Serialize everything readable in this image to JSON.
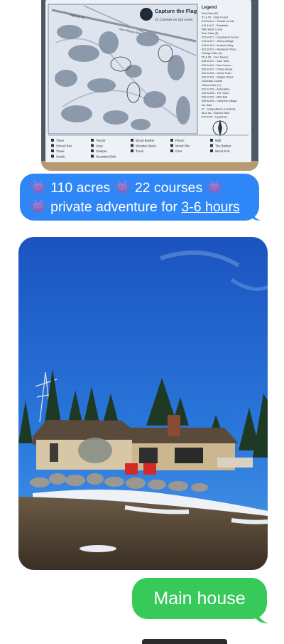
{
  "map_photo": {
    "title": "Capture the Flag",
    "subtitle": "22 Courses on 110 Acres",
    "legend_title": "Legend",
    "legend_items": [
      "Red Gate (R)",
      "#1 & #2 - Dark Forest",
      "#13 & #14 - Tractor vs Car",
      "#11 & #12 - Roadside",
      "Wild West Corral",
      "Blue Gate (B)",
      "#15 & #17 - Deadwood Forest",
      "#16 & #17 - Jimmy Bridge",
      "#18 & #19 - Ambush Alley",
      "#22 & #23 - Medieval Times",
      "Orange Gate (O)",
      "#5 & #6 - Two Towers",
      "#38 & #37 - Jack Tank",
      "#39 & #40 - Bus Course",
      "#26 & #27 - Prison Break",
      "#30 & #31 - Ghost Town",
      "#43 & #41 - Wally's World",
      "Snowball Course",
      "Yellow Gate (Y)",
      "#32 & #33 - Adrenaline",
      "#34 & #35 - The Town",
      "#36 & #37 - Blitz Ball",
      "#38 & #39 - Campers Village",
      "No Gate",
      "#7 - Gully (attack & defend)",
      "#8 & #9 - Ravens Nest",
      "#10 & #4 - Hyperball"
    ],
    "road_label": "Highway 40",
    "area_label": "Non-Playing Area",
    "key_items": [
      "Trees",
      "Tractor",
      "Wood Bunker",
      "Prison",
      "Wall",
      "School Bus",
      "Jeep",
      "Wooden Spool",
      "Wood Pile",
      "Tire Bunker",
      "Tower",
      "Camper",
      "Truck",
      "Cars",
      "Wood Fort",
      "Castle",
      "Snowbite Dish"
    ]
  },
  "messages": {
    "blue_bubble": {
      "line1_emoji1": "👾",
      "line1_text1": "110 acres",
      "line1_emoji2": "👾",
      "line1_text2": "22 courses",
      "line1_emoji3": "👾",
      "line2_emoji": "👾",
      "line2_text": "private adventure for",
      "line2_link": "3-6 hours"
    },
    "house_photo_icon": "house-photo",
    "green_bubble": "Main house"
  },
  "colors": {
    "imessage_blue": "#2f86f6",
    "imessage_green": "#37c95a",
    "sky": "#1f5fc8"
  }
}
